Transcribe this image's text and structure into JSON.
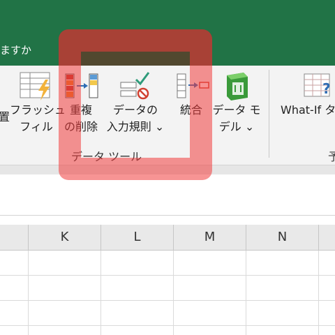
{
  "window": {
    "title_partial": "ますか"
  },
  "ribbon": {
    "buttons": {
      "partial_left": {
        "label": "置"
      },
      "flash_fill": {
        "line1": "フラッシュ",
        "line2": "フィル"
      },
      "remove_duplicates": {
        "line1": "重複",
        "line2": "の削除"
      },
      "data_validation": {
        "line1": "データの",
        "line2": "入力規則 ⌄"
      },
      "consolidate": {
        "line1": "統合"
      },
      "data_model": {
        "line1": "データ モ",
        "line2": "デル ⌄"
      },
      "what_if": {
        "line1": "What-If タ"
      }
    },
    "groups": {
      "data_tools": "データ ツール",
      "forecast_partial": "予"
    }
  },
  "sheet": {
    "columns": [
      "K",
      "L",
      "M",
      "N"
    ]
  },
  "colors": {
    "titlebar": "#217346",
    "highlight": "#f03c3c"
  }
}
